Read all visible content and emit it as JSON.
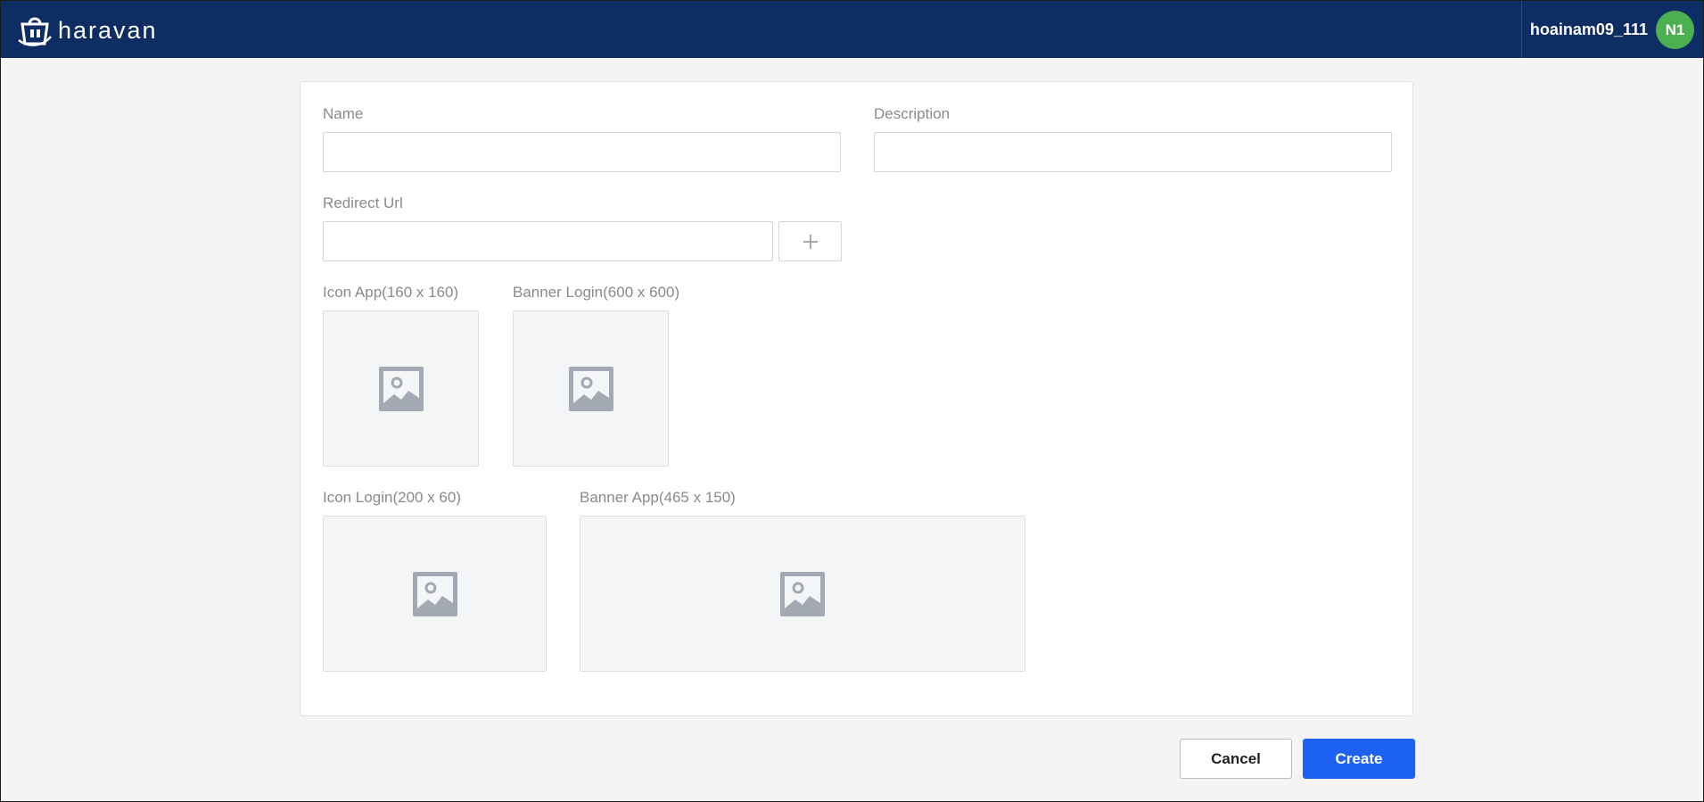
{
  "header": {
    "logo_text": "haravan",
    "username": "hoainam09_111",
    "avatar_initials": "N1",
    "bg_color": "#0d2d63",
    "avatar_color": "#4caf50"
  },
  "form": {
    "name": {
      "label": "Name",
      "value": "",
      "placeholder": ""
    },
    "description": {
      "label": "Description",
      "value": "",
      "placeholder": ""
    },
    "redirect_url": {
      "label": "Redirect Url",
      "value": "",
      "placeholder": "",
      "add_icon": "plus-icon"
    },
    "uploads": {
      "icon_app": {
        "label": "Icon App(160 x 160)",
        "icon": "image-placeholder-icon"
      },
      "banner_login": {
        "label": "Banner Login(600 x 600)",
        "icon": "image-placeholder-icon"
      },
      "icon_login": {
        "label": "Icon Login(200 x 60)",
        "icon": "image-placeholder-icon"
      },
      "banner_app": {
        "label": "Banner App(465 x 150)",
        "icon": "image-placeholder-icon"
      }
    }
  },
  "actions": {
    "cancel_label": "Cancel",
    "create_label": "Create",
    "create_color": "#1e62f5"
  }
}
